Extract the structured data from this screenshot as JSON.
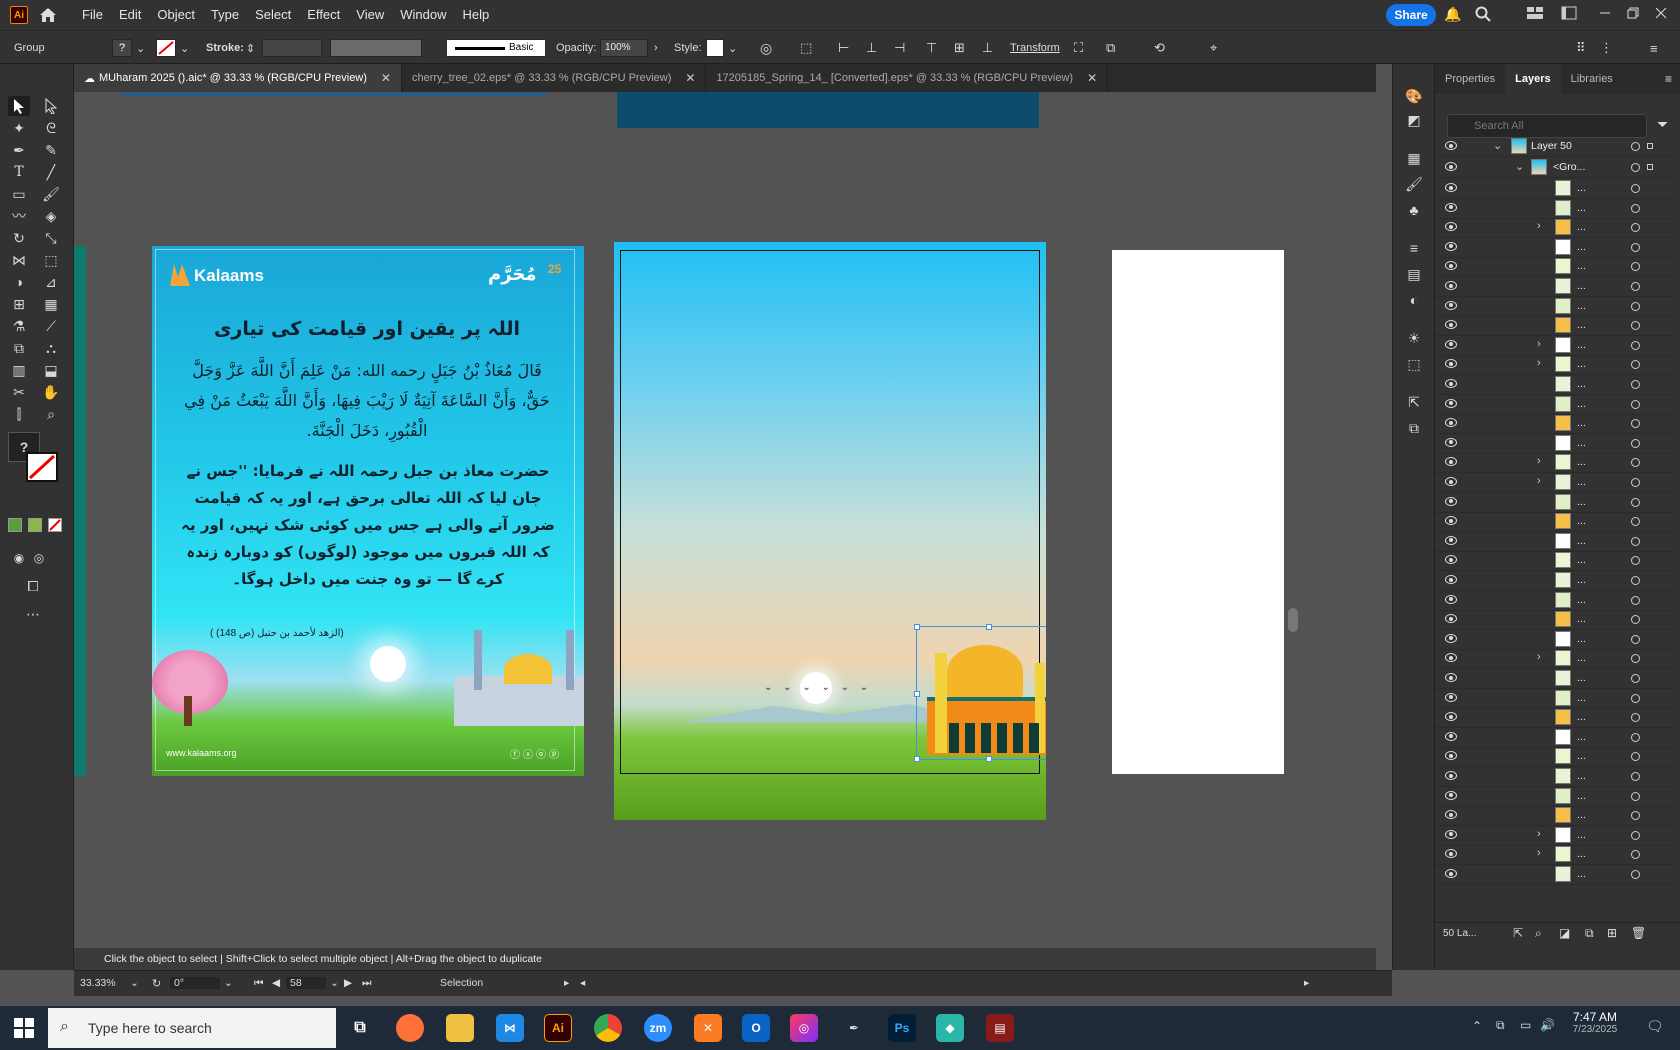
{
  "menubar": {
    "app_icon": "Ai",
    "items": [
      "File",
      "Edit",
      "Object",
      "Type",
      "Select",
      "Effect",
      "View",
      "Window",
      "Help"
    ],
    "share_label": "Share"
  },
  "control": {
    "selection_type": "Group",
    "stroke_label": "Stroke:",
    "brush_label": "Basic",
    "opacity_label": "Opacity:",
    "opacity_value": "100%",
    "style_label": "Style:",
    "transform_label": "Transform"
  },
  "tabs": [
    {
      "label": "MUharam 2025 ().aic* @ 33.33 % (RGB/CPU Preview)",
      "active": true
    },
    {
      "label": "cherry_tree_02.eps* @ 33.33 % (RGB/CPU Preview)",
      "active": false
    },
    {
      "label": "17205185_Spring_14_ [Converted].eps* @ 33.33 % (RGB/CPU Preview)",
      "active": false
    }
  ],
  "panel": {
    "tabs": [
      "Properties",
      "Layers",
      "Libraries"
    ],
    "active_tab": "Layers",
    "search_placeholder": "Search All",
    "layer_name": "Layer 50",
    "group_name": "<Gro...",
    "sublayer_label": "...",
    "footer_count": "50 La..."
  },
  "artboard1": {
    "brand": "Kalaams",
    "badge_number": "25",
    "badge_text": "مُحَرَّم",
    "heading": "اللہ پر یقین اور قیامت کی تیاری",
    "arabic": "قَالَ مُعَاذُ بْنُ جَبَلٍ رحمه الله: مَنْ عَلِمَ أَنَّ اللَّهَ عَزَّ وَجَلَّ حَقٌّ، وَأَنَّ السَّاعَةَ آتِيَةٌ لَا رَيْبَ فِيهَا، وَأَنَّ اللَّهَ يَبْعَثُ مَنْ فِي الْقُبُورِ، دَخَلَ الْجَنَّةَ.",
    "urdu": "حضرت معاذ بن جبل رحمہ اللہ نے فرمایا: ''جس نے جان لیا کہ اللہ تعالی برحق ہے، اور یہ کہ قیامت ضرور آنے والی ہے جس میں کوئی شک نہیں، اور یہ کہ اللہ قبروں میں موجود (لوگوں) کو دوبارہ زندہ کرے گا — تو وہ جنت میں داخل ہوگا۔",
    "reference": "(الزهد لأحمد بن حنبل (ص 148) )",
    "website": "www.kalaams.org"
  },
  "status": {
    "zoom": "33.33%",
    "rotation": "0°",
    "artboard_number": "58",
    "tool_name": "Selection",
    "hint": "Click the object to select  |  Shift+Click to select multiple object  |  Alt+Drag the object to duplicate"
  },
  "taskbar": {
    "search_placeholder": "Type here to search",
    "time": "7:47 AM",
    "date": "7/23/2025"
  },
  "colors": {
    "accent": "#1473e6",
    "ui_dark": "#323232",
    "canvas": "#535353"
  }
}
